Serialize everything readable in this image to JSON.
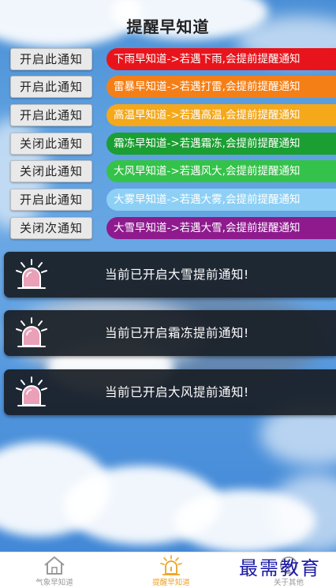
{
  "page": {
    "title": "提醒早知道"
  },
  "notifications": [
    {
      "toggle_label": "开启此通知",
      "text": "下雨早知道->若遇下雨,会提前提醒通知",
      "color": "#e8141c"
    },
    {
      "toggle_label": "开启此通知",
      "text": "雷暴早知道->若遇打雷,会提前提醒通知",
      "color": "#f57f17"
    },
    {
      "toggle_label": "开启此通知",
      "text": "高温早知道->若遇高温,会提前提醒通知",
      "color": "#f4a81a"
    },
    {
      "toggle_label": "关闭此通知",
      "text": "霜冻早知道->若遇霜冻,会提前提醒通知",
      "color": "#1b9e32"
    },
    {
      "toggle_label": "关闭此通知",
      "text": "大风早知道->若遇风大,会提前提醒通知",
      "color": "#35c24a"
    },
    {
      "toggle_label": "开启此通知",
      "text": "大雾早知道->若遇大雾,会提前提醒通知",
      "color": "#8ed0f5"
    },
    {
      "toggle_label": "关闭次通知",
      "text": "大雪早知道->若遇大雪,会提前提醒通知",
      "color": "#8e1a8e"
    }
  ],
  "active_alerts": [
    {
      "message": "当前已开启大雪提前通知!",
      "icon": "alarm-light-icon"
    },
    {
      "message": "当前已开启霜冻提前通知!",
      "icon": "alarm-light-icon"
    },
    {
      "message": "当前已开启大风提前通知!",
      "icon": "alarm-light-icon"
    }
  ],
  "tabbar": {
    "tabs": [
      {
        "label": "气象早知道",
        "icon": "house-icon",
        "active": false
      },
      {
        "label": "提醒早知道",
        "icon": "alarm-light-icon",
        "active": true
      },
      {
        "label": "关于其他",
        "icon": "info-icon",
        "active": false
      }
    ]
  },
  "watermark": "最需教育",
  "colors": {
    "active_tab": "#f0a020",
    "card_bg": "#191e26"
  }
}
